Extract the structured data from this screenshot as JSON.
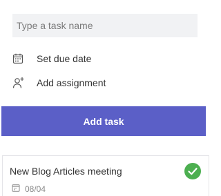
{
  "form": {
    "task_name_placeholder": "Type a task name",
    "task_name_value": "",
    "due_date_label": "Set due date",
    "due_date_icon": "calendar-icon",
    "assignment_label": "Add assignment",
    "assignment_icon": "add-person-icon",
    "add_task_label": "Add task"
  },
  "tasks": [
    {
      "title": "New Blog Articles meeting",
      "due": "08/04",
      "due_icon": "calendar-icon",
      "status_icon": "checkmark-icon",
      "completed": true
    }
  ],
  "colors": {
    "accent": "#5b5fc7",
    "complete": "#4caf50",
    "input_bg": "#f1f2f4",
    "text": "#333333",
    "muted": "#8a8a8a"
  }
}
